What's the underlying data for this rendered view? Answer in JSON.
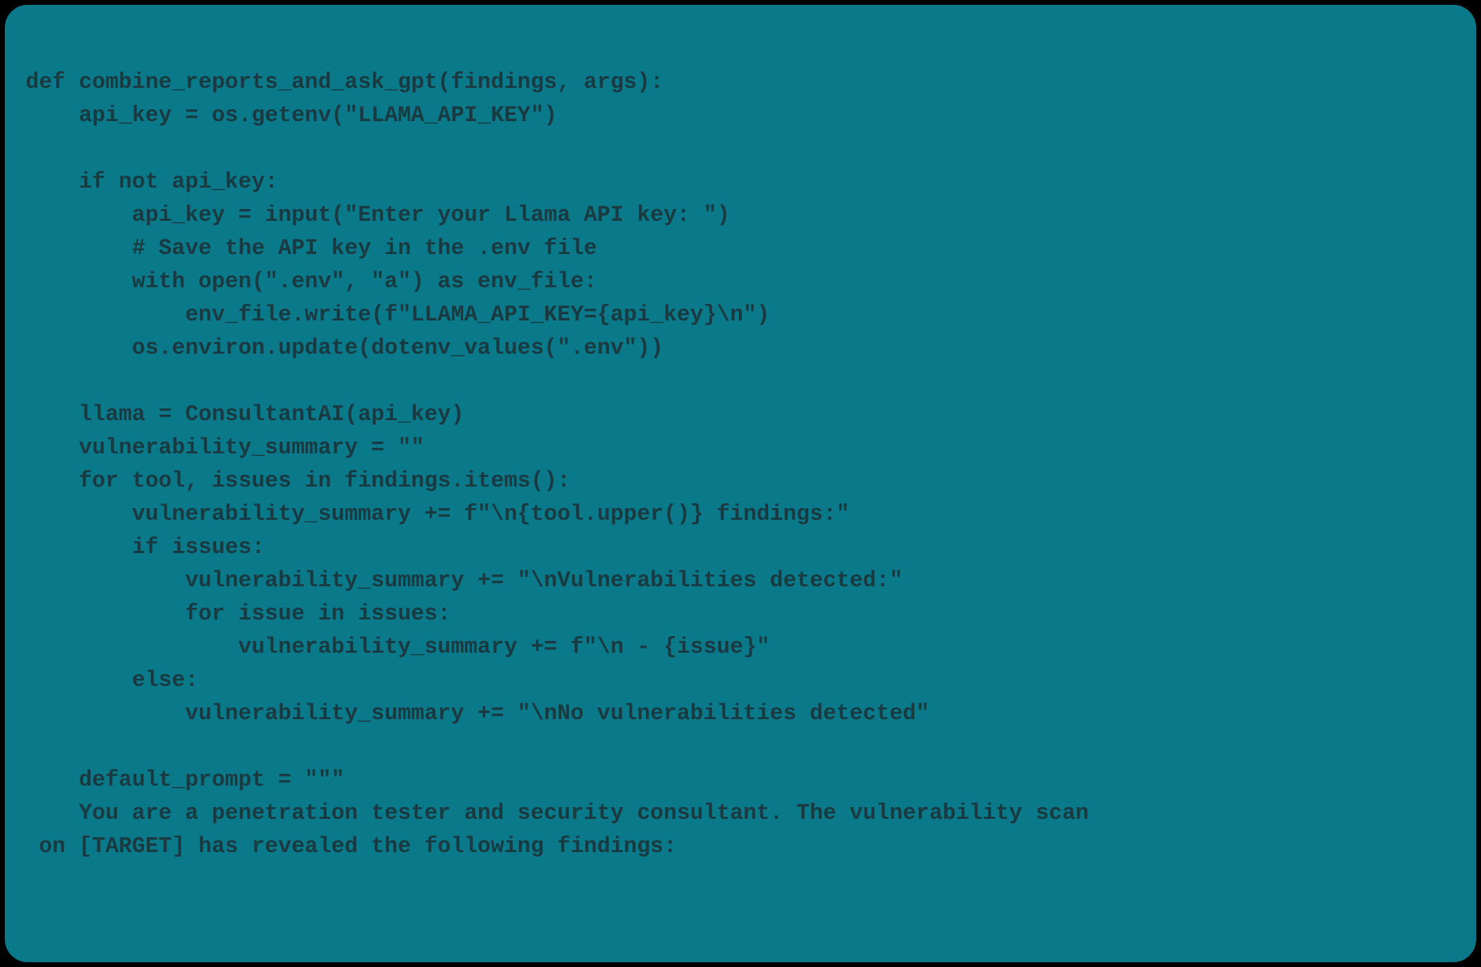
{
  "code": {
    "lines": [
      "",
      "def combine_reports_and_ask_gpt(findings, args):",
      "    api_key = os.getenv(\"LLAMA_API_KEY\")",
      "",
      "    if not api_key:",
      "        api_key = input(\"Enter your Llama API key: \")",
      "        # Save the API key in the .env file",
      "        with open(\".env\", \"a\") as env_file:",
      "            env_file.write(f\"LLAMA_API_KEY={api_key}\\n\")",
      "        os.environ.update(dotenv_values(\".env\"))",
      "",
      "    llama = ConsultantAI(api_key)",
      "    vulnerability_summary = \"\"",
      "    for tool, issues in findings.items():",
      "        vulnerability_summary += f\"\\n{tool.upper()} findings:\"",
      "        if issues:",
      "            vulnerability_summary += \"\\nVulnerabilities detected:\"",
      "            for issue in issues:",
      "                vulnerability_summary += f\"\\n - {issue}\"",
      "        else:",
      "            vulnerability_summary += \"\\nNo vulnerabilities detected\"",
      "",
      "    default_prompt = \"\"\"",
      "    You are a penetration tester and security consultant. The vulnerability scan",
      " on [TARGET] has revealed the following findings:"
    ]
  },
  "colors": {
    "background": "#0a7a8a",
    "text": "#1a3a42",
    "border": "#000000"
  }
}
